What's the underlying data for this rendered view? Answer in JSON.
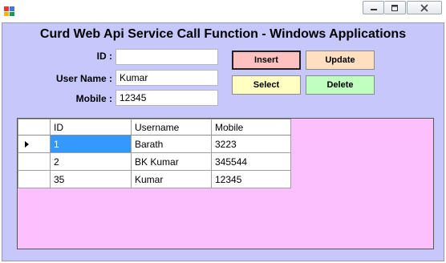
{
  "form": {
    "title": "Curd Web Api Service Call Function - Windows Applications"
  },
  "fields": {
    "id_label": "ID :",
    "id_value": "",
    "username_label": "User Name :",
    "username_value": "Kumar",
    "mobile_label": "Mobile :",
    "mobile_value": "12345"
  },
  "buttons": {
    "insert": "Insert",
    "update": "Update",
    "select": "Select",
    "delete": "Delete"
  },
  "colors": {
    "client_bg": "#c6c8fc",
    "grid_bg": "#fdc0fe",
    "insert_bg": "#ffc0c0",
    "update_bg": "#ffdfbf",
    "select_bg": "#ffffc0",
    "delete_bg": "#c0ffc0",
    "selection": "#3399ff"
  },
  "grid": {
    "columns": [
      "ID",
      "Username",
      "Mobile"
    ],
    "rows": [
      [
        "1",
        "Barath",
        "3223"
      ],
      [
        "2",
        "BK Kumar",
        "345544"
      ],
      [
        "35",
        "Kumar",
        "12345"
      ]
    ]
  }
}
